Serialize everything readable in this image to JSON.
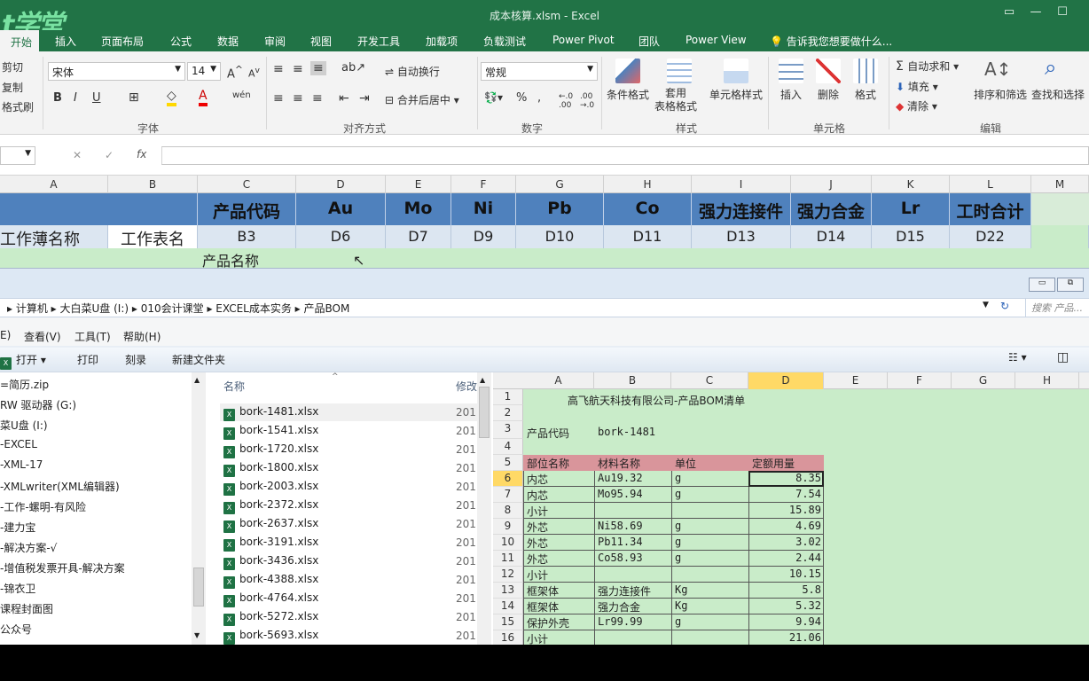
{
  "window": {
    "title": "成本核算.xlsm - Excel",
    "logo": "t学堂"
  },
  "tabs": [
    "开始",
    "插入",
    "页面布局",
    "公式",
    "数据",
    "审阅",
    "视图",
    "开发工具",
    "加载项",
    "负载测试",
    "Power Pivot",
    "团队",
    "Power View"
  ],
  "tell_me": "告诉我您想要做什么...",
  "clipboard": {
    "cut": "剪切",
    "copy": "复制",
    "format_painter": "格式刷"
  },
  "font": {
    "name": "宋体",
    "size": "14",
    "group": "字体",
    "bold": "B",
    "italic": "I",
    "underline": "U"
  },
  "alignment": {
    "wrap": "自动换行",
    "merge": "合并后居中",
    "group": "对齐方式"
  },
  "number": {
    "format": "常规",
    "group": "数字"
  },
  "styles": {
    "conditional": "条件格式",
    "table": "套用\n表格格式",
    "cell": "单元格样式",
    "group": "样式"
  },
  "cells": {
    "insert": "插入",
    "delete": "删除",
    "format": "格式",
    "group": "单元格"
  },
  "editing": {
    "autosum": "自动求和",
    "fill": "填充",
    "clear": "清除",
    "sort": "排序和筛选",
    "find": "查找和选择",
    "group": "编辑"
  },
  "formula_bar": {
    "name_box": "",
    "fx": "fx",
    "cancel": "✕",
    "enter": "✓"
  },
  "sheet": {
    "columns": [
      "A",
      "B",
      "C",
      "D",
      "E",
      "F",
      "G",
      "H",
      "I",
      "J",
      "K",
      "L",
      "M"
    ],
    "row1": [
      "产品代码",
      "Au",
      "Mo",
      "Ni",
      "Pb",
      "Co",
      "强力连接件",
      "强力合金",
      "Lr",
      "工时合计"
    ],
    "row2": [
      "工作薄名称",
      "工作表名",
      "B3",
      "D6",
      "D7",
      "D9",
      "D10",
      "D11",
      "D13",
      "D14",
      "D15",
      "D22"
    ],
    "row3": "产品名称"
  },
  "explorer": {
    "breadcrumb": [
      "计算机",
      "大白菜U盘 (I:)",
      "010会计课堂",
      "EXCEL成本实务",
      "产品BOM"
    ],
    "search_placeholder": "搜索 产品...",
    "menu": [
      "E)",
      "查看(V)",
      "工具(T)",
      "帮助(H)"
    ],
    "toolbar": [
      "打开",
      "打印",
      "刻录",
      "新建文件夹"
    ],
    "nav_items": [
      "=简历.zip",
      "RW 驱动器 (G:)",
      "菜U盘 (I:)",
      "-EXCEL",
      "-XML-17",
      "-XMLwriter(XML编辑器)",
      "-工作-螺明-有风险",
      "-建力宝",
      "-解决方案-√",
      "-增值税发票开具-解决方案",
      "-锦衣卫",
      "课程封面图",
      "公众号"
    ],
    "col_name": "名称",
    "col_modified": "修改",
    "files": [
      "bork-1481.xlsx",
      "bork-1541.xlsx",
      "bork-1720.xlsx",
      "bork-1800.xlsx",
      "bork-2003.xlsx",
      "bork-2372.xlsx",
      "bork-2637.xlsx",
      "bork-3191.xlsx",
      "bork-3436.xlsx",
      "bork-4388.xlsx",
      "bork-4764.xlsx",
      "bork-5272.xlsx",
      "bork-5693.xlsx"
    ],
    "file_date": "201"
  },
  "preview": {
    "columns": [
      "A",
      "B",
      "C",
      "D",
      "E",
      "F",
      "G",
      "H"
    ],
    "title": "高飞航天科技有限公司-产品BOM清单",
    "code_label": "产品代码",
    "code_value": "bork-1481",
    "headers": [
      "部位名称",
      "材料名称",
      "单位",
      "定额用量"
    ],
    "rows": [
      {
        "n": "6",
        "a": "内芯",
        "b": "Au19.32",
        "c": "g",
        "d": "8.35"
      },
      {
        "n": "7",
        "a": "内芯",
        "b": "Mo95.94",
        "c": "g",
        "d": "7.54"
      },
      {
        "n": "8",
        "a": "小计",
        "b": "",
        "c": "",
        "d": "15.89"
      },
      {
        "n": "9",
        "a": "外芯",
        "b": "Ni58.69",
        "c": "g",
        "d": "4.69"
      },
      {
        "n": "10",
        "a": "外芯",
        "b": "Pb11.34",
        "c": "g",
        "d": "3.02"
      },
      {
        "n": "11",
        "a": "外芯",
        "b": "Co58.93",
        "c": "g",
        "d": "2.44"
      },
      {
        "n": "12",
        "a": "小计",
        "b": "",
        "c": "",
        "d": "10.15"
      },
      {
        "n": "13",
        "a": "框架体",
        "b": "强力连接件",
        "c": "Kg",
        "d": "5.8"
      },
      {
        "n": "14",
        "a": "框架体",
        "b": "强力合金",
        "c": "Kg",
        "d": "5.32"
      },
      {
        "n": "15",
        "a": "保护外壳",
        "b": "Lr99.99",
        "c": "g",
        "d": "9.94"
      },
      {
        "n": "16",
        "a": "小计",
        "b": "",
        "c": "",
        "d": "21.06"
      }
    ]
  },
  "colors": {
    "excel_green": "#217346",
    "header_blue": "#4f81bd",
    "sheet_green": "#c9ecc9",
    "bom_header": "#d9959b"
  }
}
